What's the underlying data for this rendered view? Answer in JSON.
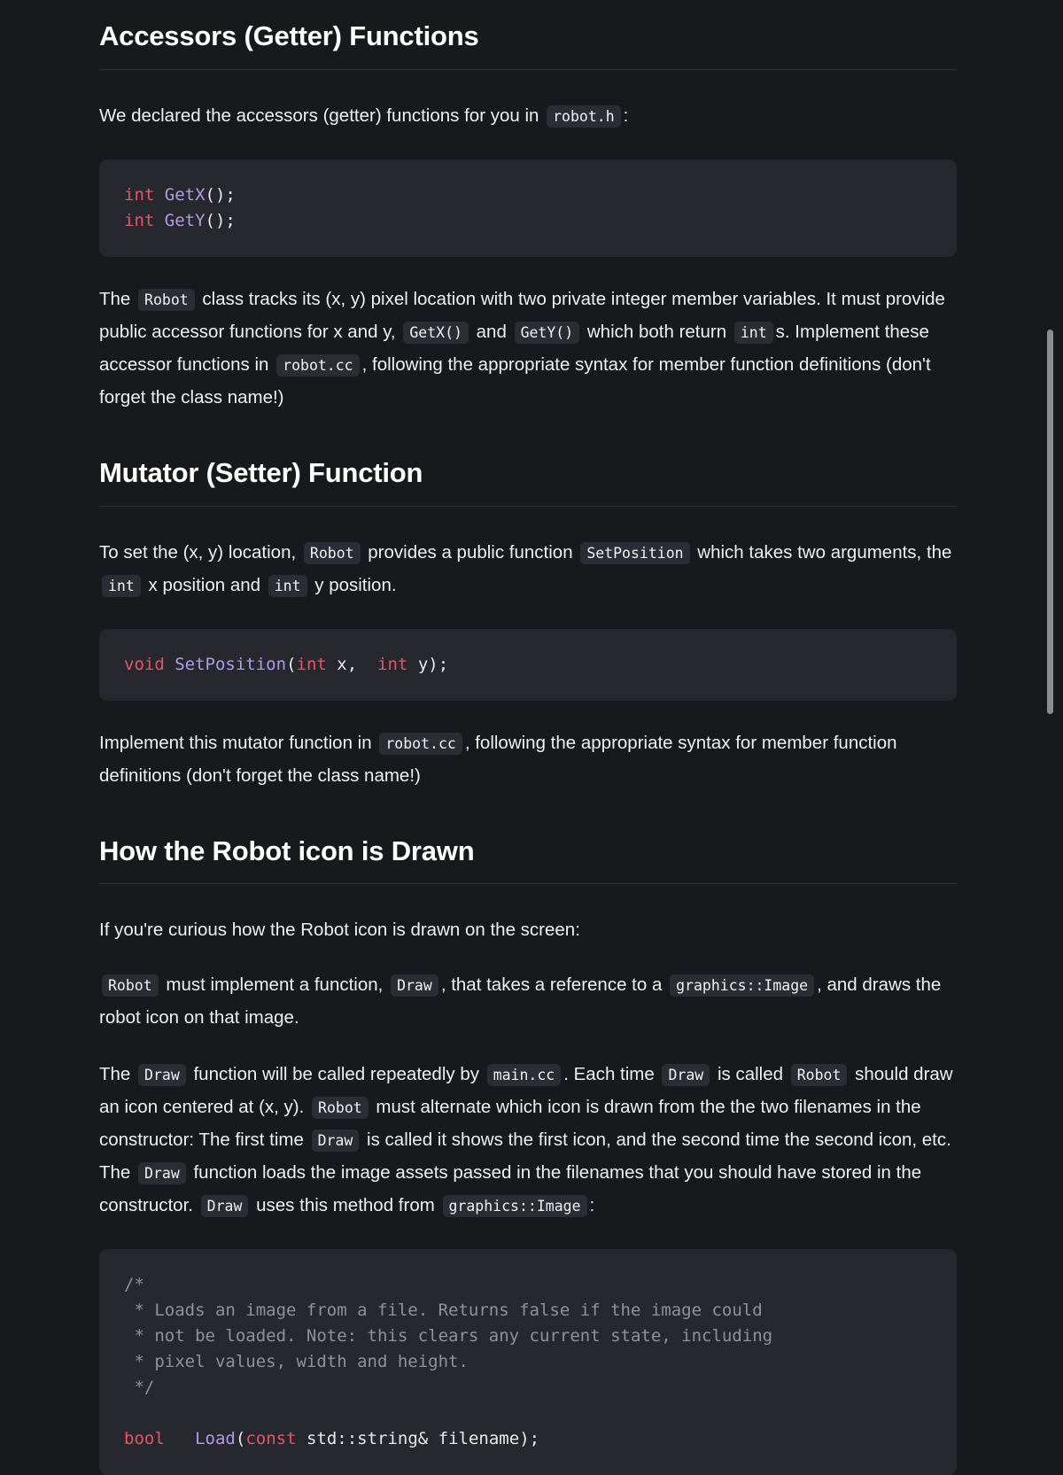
{
  "theme": {
    "page_background": "#17191c",
    "code_block_background": "#26282d",
    "inline_code_background": "#2a2d33",
    "text_color": "#eef0f2",
    "keyword_color": "#e2566c",
    "function_color": "#b29ae8",
    "comment_color": "#8d9399",
    "divider_color": "#2e3136",
    "scrollbar_color": "#8a8d91"
  },
  "sections": {
    "accessors": {
      "heading": "Accessors (Getter) Functions",
      "intro": {
        "t1": "We declared the accessors (getter) functions for you in",
        "c1": "robot.h",
        "t2": ":"
      },
      "code": {
        "line1_kw": "int",
        "line1_fn": "GetX",
        "line1_tail": "();",
        "line2_kw": "int",
        "line2_fn": "GetY",
        "line2_tail": "();"
      },
      "body": {
        "t1": "The",
        "c1": "Robot",
        "t2": "class tracks its (x, y) pixel location with two private integer member variables. It must provide public accessor functions for x and y,",
        "c2": "GetX()",
        "t3": "and",
        "c3": "GetY()",
        "t4": "which both return",
        "c4": "int",
        "t5": "s. Implement these accessor functions in",
        "c5": "robot.cc",
        "t6": ", following the appropriate syntax for member function definitions (don't forget the class name!)"
      }
    },
    "mutator": {
      "heading": "Mutator (Setter) Function",
      "body": {
        "t1": "To set the (x, y) location,",
        "c1": "Robot",
        "t2": "provides a public function",
        "c2": "SetPosition",
        "t3": "which takes two arguments, the",
        "c3": "int",
        "t4": "x position and",
        "c4": "int",
        "t5": "y position."
      },
      "code": {
        "kw_void": "void",
        "fn_name": "SetPosition",
        "paren_open": "(",
        "kw_int_1": "int",
        "arg_x": " x,  ",
        "kw_int_2": "int",
        "arg_y": " y);"
      },
      "footer": {
        "t1": "Implement this mutator function in",
        "c1": "robot.cc",
        "t2": ", following the appropriate syntax for member function definitions (don't forget the class name!)"
      }
    },
    "draw": {
      "heading": "How the Robot icon is Drawn",
      "intro": "If you're curious how the Robot icon is drawn on the screen:",
      "requirement": {
        "c1": "Robot",
        "t1": "must implement a function,",
        "c2": "Draw",
        "t2": ", that takes a reference to a",
        "c3": "graphics::Image",
        "t3": ", and draws the robot icon on that image."
      },
      "details": {
        "t1": "The",
        "c1": "Draw",
        "t2": "function will be called repeatedly by",
        "c2": "main.cc",
        "t3": ". Each time",
        "c3": "Draw",
        "t4": "is called",
        "c4": "Robot",
        "t5": "should draw an icon centered at (x, y).",
        "c5": "Robot",
        "t6": "must alternate which icon is drawn from the the two filenames in the constructor: The first time",
        "c6": "Draw",
        "t7": "is called it shows the first icon, and the second time the second icon, etc. The",
        "c7": "Draw",
        "t8": "function loads the image assets passed in the filenames that you should have stored in the constructor.",
        "c8": "Draw",
        "t9": "uses this method from",
        "c9": "graphics::Image",
        "t10": ":"
      },
      "code": {
        "comment": "/*\n * Loads an image from a file. Returns false if the image could\n * not be loaded. Note: this clears any current state, including\n * pixel values, width and height.\n */",
        "blank": "",
        "kw_bool": "bool",
        "space": "  ",
        "fn_name": "Load",
        "paren_open": "(",
        "kw_const": "const",
        "tail": " std::string& filename);"
      }
    }
  }
}
